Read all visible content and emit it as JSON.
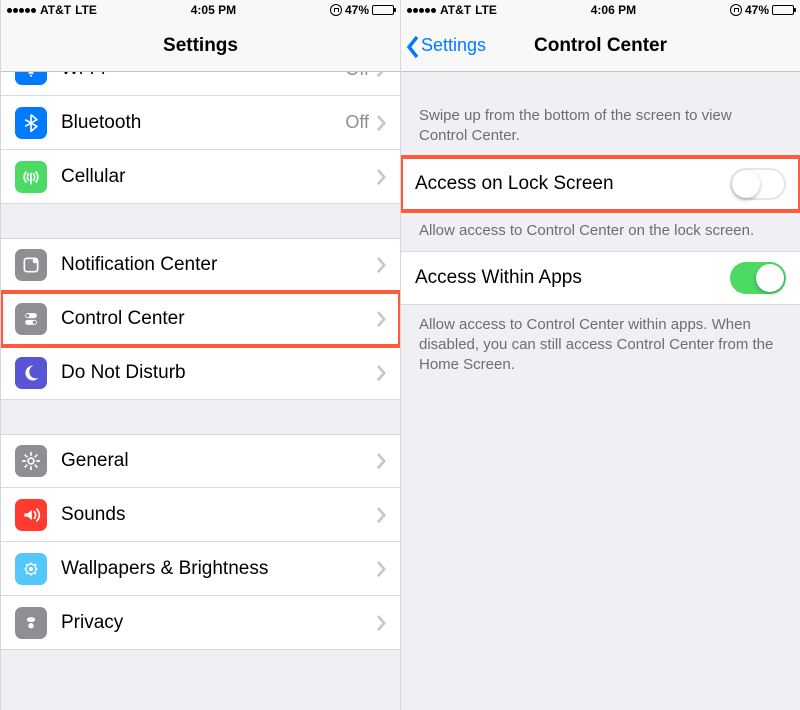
{
  "left": {
    "status": {
      "carrier": "AT&T",
      "network": "LTE",
      "time": "4:05 PM",
      "battery_pct": "47%"
    },
    "nav": {
      "title": "Settings"
    },
    "rows": {
      "wifi": {
        "label": "Wi-Fi",
        "value": "Off"
      },
      "bluetooth": {
        "label": "Bluetooth",
        "value": "Off"
      },
      "cellular": {
        "label": "Cellular"
      },
      "notif": {
        "label": "Notification Center"
      },
      "control": {
        "label": "Control Center"
      },
      "dnd": {
        "label": "Do Not Disturb"
      },
      "general": {
        "label": "General"
      },
      "sounds": {
        "label": "Sounds"
      },
      "wallpaper": {
        "label": "Wallpapers & Brightness"
      },
      "privacy": {
        "label": "Privacy"
      }
    }
  },
  "right": {
    "status": {
      "carrier": "AT&T",
      "network": "LTE",
      "time": "4:06 PM",
      "battery_pct": "47%"
    },
    "nav": {
      "back": "Settings",
      "title": "Control Center"
    },
    "hint1": "Swipe up from the bottom of the screen to view Control Center.",
    "row_lock": {
      "label": "Access on Lock Screen"
    },
    "desc_lock": "Allow access to Control Center on the lock screen.",
    "row_apps": {
      "label": "Access Within Apps"
    },
    "desc_apps": "Allow access to Control Center within apps. When disabled, you can still access Control Center from the Home Screen."
  },
  "colors": {
    "wifi": "#007aff",
    "bluetooth": "#007aff",
    "cellular": "#4cd964",
    "notif": "#8e8e93",
    "control": "#8e8e93",
    "dnd": "#5856d6",
    "general": "#8e8e93",
    "sounds": "#ff3b30",
    "wallpaper": "#54c7fc",
    "privacy": "#8e8e93"
  },
  "icon_glyph_color": "#ffffff"
}
